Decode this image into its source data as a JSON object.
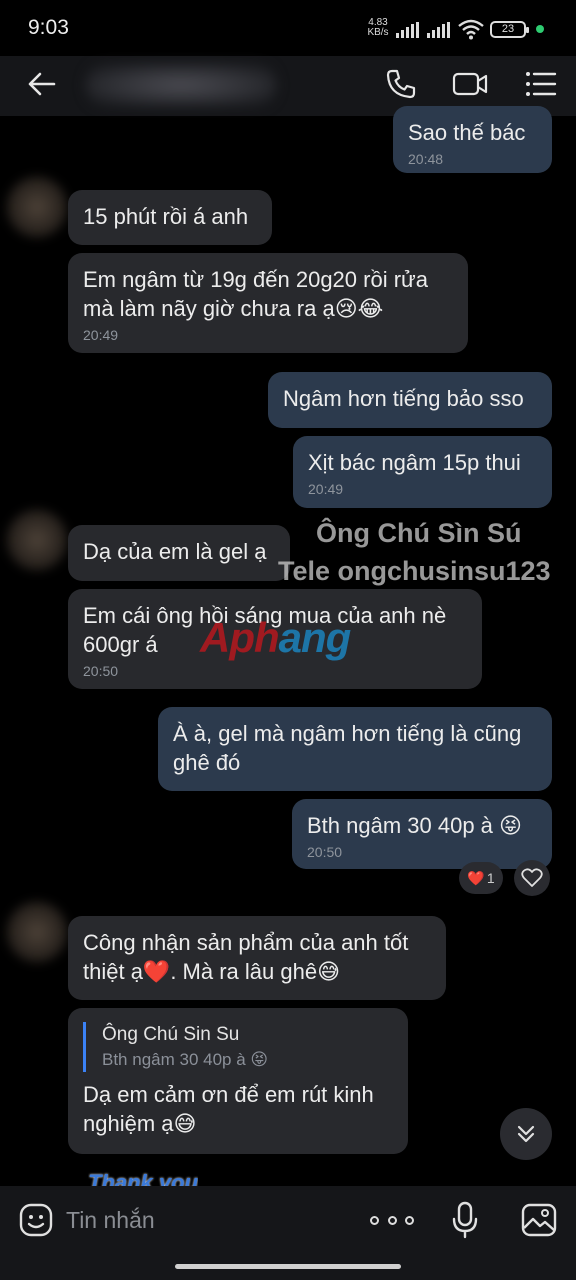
{
  "status": {
    "time": "9:03",
    "net_speed_value": "4.83",
    "net_speed_unit": "KB/s",
    "battery": "23"
  },
  "header": {
    "back_icon": "arrow-left-icon",
    "call_icon": "phone-icon",
    "video_icon": "video-camera-icon",
    "menu_icon": "list-menu-icon"
  },
  "messages": [
    {
      "side": "out",
      "text": "Sao thế  bác",
      "time": "20:48"
    },
    {
      "side": "in",
      "text": "15 phút rồi á anh"
    },
    {
      "side": "in",
      "text": "Em ngâm từ 19g đến 20g20 rồi rửa mà làm nãy giờ chưa ra ạ😢😂",
      "time": "20:49"
    },
    {
      "side": "out",
      "text": "Ngâm hơn tiếng bảo sso"
    },
    {
      "side": "out",
      "text": "Xịt bác ngâm 15p thui",
      "time": "20:49"
    },
    {
      "side": "in",
      "text": "Dạ của em là gel ạ"
    },
    {
      "side": "in",
      "text": "Em cái ông hồi sáng mua của anh nè 600gr á",
      "time": "20:50"
    },
    {
      "side": "out",
      "text": "À à, gel mà ngâm hơn tiếng là cũng ghê đó"
    },
    {
      "side": "out",
      "text": "Bth ngâm 30 40p à 😝",
      "time": "20:50"
    },
    {
      "side": "in",
      "text": "Công nhận sản phẩm của anh tốt thiệt ạ❤️. Mà ra lâu ghê😅"
    },
    {
      "side": "in",
      "reply_name": "Ông Chú Sin Su",
      "reply_text": "Bth ngâm 30 40p à 😝",
      "text": "Dạ em cảm ơn để em rút kinh nghiệm ạ😅"
    }
  ],
  "reaction": {
    "emoji": "❤️",
    "count": "1"
  },
  "watermark": {
    "line1": "Ông Chú Sìn Sú",
    "line2": "Tele ongchusinsu123",
    "logo_part1": "Aph",
    "logo_part2": "ang"
  },
  "sticker_peek_text": "Thank you",
  "input": {
    "placeholder": "Tin nhắn",
    "emoji_icon": "smiley-icon",
    "more_icon": "more-dots-icon",
    "mic_icon": "microphone-icon",
    "image_icon": "image-icon"
  },
  "colors": {
    "incoming_bubble": "#28292d",
    "outgoing_bubble": "#2c3a4d",
    "accent": "#3b82f6"
  }
}
